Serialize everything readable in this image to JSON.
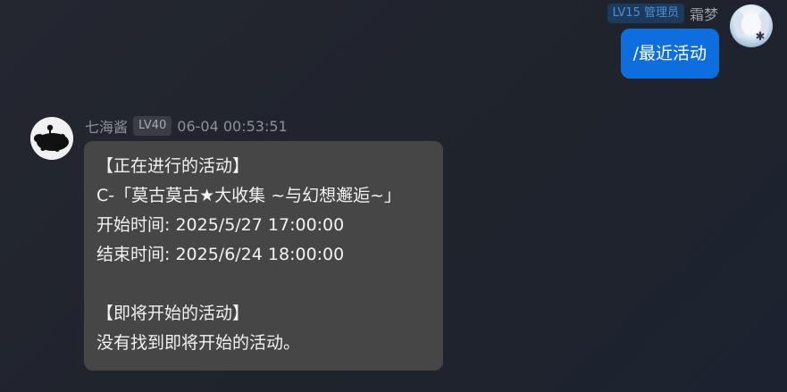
{
  "outgoing": {
    "badge": "LV15 管理员",
    "sender": "霜梦",
    "avatar_icon": "user-avatar-icon",
    "message": "/最近活动",
    "bubble_color": "#0e6ede"
  },
  "incoming": {
    "sender": "七海酱",
    "level_badge": "LV40",
    "timestamp": "06-04 00:53:51",
    "avatar_icon": "bot-avatar-icon",
    "bubble_color": "#464646",
    "lines": [
      "【正在进行的活动】",
      "C-「莫古莫古★大收集 ~与幻想邂逅~」",
      "开始时间: 2025/5/27 17:00:00",
      "结束时间: 2025/6/24 18:00:00",
      "",
      "【即将开始的活动】",
      "没有找到即将开始的活动。"
    ]
  }
}
